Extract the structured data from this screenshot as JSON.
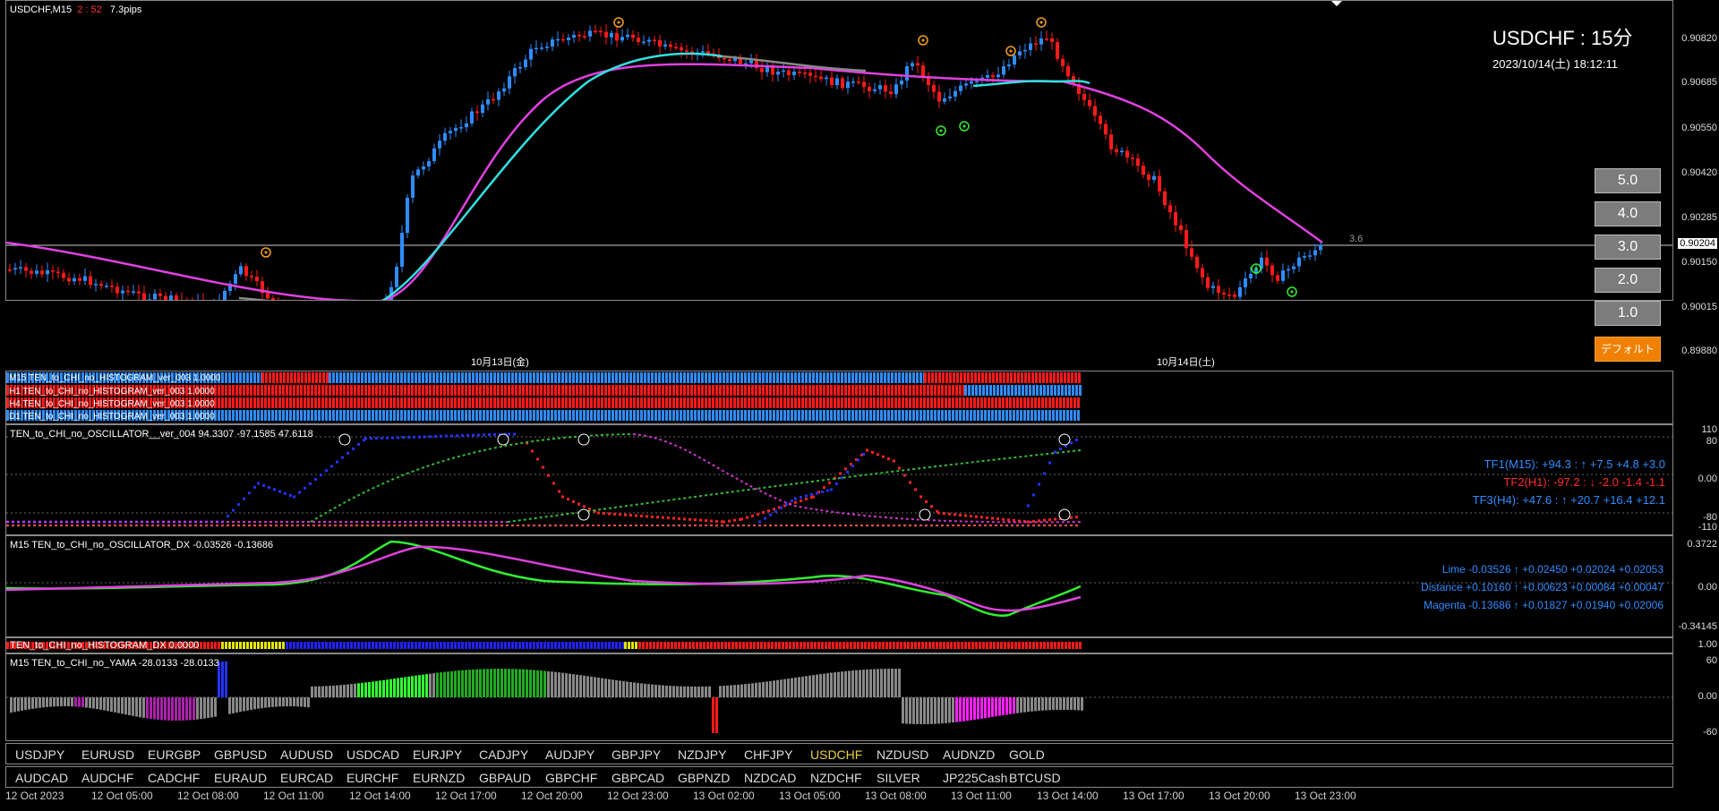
{
  "chart_header": {
    "symbol": "USDCHF,M15",
    "countdown": "2 : 52",
    "spread": "7.3pips"
  },
  "title_block": {
    "title": "USDCHF : 15分",
    "datetime": "2023/10/14(土) 18:12:11"
  },
  "price_scale": [
    "0.90820",
    "0.90685",
    "0.90550",
    "0.90420",
    "0.90285",
    "0.90204",
    "0.90150",
    "0.90015",
    "0.89880"
  ],
  "current_price": "0.90204",
  "spread_label": "3.6",
  "date_labels": [
    "10月13日(金)",
    "10月14日(土)"
  ],
  "level_buttons": [
    "5.0",
    "4.0",
    "3.0",
    "2.0",
    "1.0"
  ],
  "default_button": "デフォルト",
  "histogram_rows": [
    "M15 TEN_to_CHI_no_HISTOGRAM_ver_003 1.0000",
    "H1 TEN_to_CHI_no_HISTOGRAM_ver_003 1.0000",
    "H4 TEN_to_CHI_no_HISTOGRAM_ver_003 1.0000",
    "D1 TEN_to_CHI_no_HISTOGRAM_ver_003 1.0000"
  ],
  "oscillator": {
    "label": "TEN_to_CHI_no_OSCILLATOR__ver_004 94.3307 -97.1585 47.6118",
    "scale": [
      "110",
      "80",
      "0.00",
      "-80",
      "-110"
    ],
    "tf_lines": [
      {
        "name": "TF1(M15)",
        "value": ": +94.3 : ↑ +7.5 +4.8 +3.0",
        "color": "#2f8cff"
      },
      {
        "name": "TF2(H1)",
        "value": ": -97.2 : ↓ -2.0 -1.4 -1.1",
        "color": "#ff2a2a"
      },
      {
        "name": "TF3(H4)",
        "value": ": +47.6 : ↑ +20.7 +16.4 +12.1",
        "color": "#2f8cff"
      }
    ]
  },
  "dx": {
    "label": "M15 TEN_to_CHI_no_OSCILLATOR_DX -0.03526 -0.13686",
    "scale": [
      "0.3722",
      "0.00",
      "-0.34145"
    ],
    "lines": [
      {
        "name": "Lime",
        "value": "-0.03526 ↑ +0.02450 +0.02024 +0.02053"
      },
      {
        "name": "Distance",
        "value": "+0.10160 ↑ +0.00623 +0.00084 +0.00047"
      },
      {
        "name": "Magenta",
        "value": "-0.13686 ↑ +0.01827 +0.01940 +0.02006"
      }
    ]
  },
  "histogram_dx": {
    "label": "TEN_to_CHI_no_HISTOGRAM_DX 0.0000",
    "scale": "1.00"
  },
  "yama": {
    "label": "M15 TEN_to_CHI_no_YAMA -28.0133 -28.0133",
    "scale": [
      "60",
      "0.00",
      "-60"
    ]
  },
  "symbols_row1": [
    "USDJPY",
    "EURUSD",
    "EURGBP",
    "GBPUSD",
    "AUDUSD",
    "USDCAD",
    "EURJPY",
    "CADJPY",
    "AUDJPY",
    "GBPJPY",
    "NZDJPY",
    "CHFJPY",
    "USDCHF",
    "NZDUSD",
    "AUDNZD",
    "GOLD"
  ],
  "active_symbol": "USDCHF",
  "symbols_row2": [
    "AUDCAD",
    "AUDCHF",
    "CADCHF",
    "EURAUD",
    "EURCAD",
    "EURCHF",
    "EURNZD",
    "GBPAUD",
    "GBPCHF",
    "GBPCAD",
    "GBPNZD",
    "NZDCAD",
    "NZDCHF",
    "SILVER",
    "JP225Cash",
    "BTCUSD"
  ],
  "time_axis": [
    "12 Oct 2023",
    "12 Oct 05:00",
    "12 Oct 08:00",
    "12 Oct 11:00",
    "12 Oct 14:00",
    "12 Oct 17:00",
    "12 Oct 20:00",
    "12 Oct 23:00",
    "13 Oct 02:00",
    "13 Oct 05:00",
    "13 Oct 08:00",
    "13 Oct 11:00",
    "13 Oct 14:00",
    "13 Oct 17:00",
    "13 Oct 20:00",
    "13 Oct 23:00"
  ],
  "colors": {
    "bull": "#2f8cff",
    "bear": "#ff1a1a",
    "cyan_ma": "#33e0e0",
    "magenta_ma": "#e040e0",
    "lime": "#33ee33",
    "accent": "#f08000",
    "active_symbol": "#e6d24a"
  }
}
